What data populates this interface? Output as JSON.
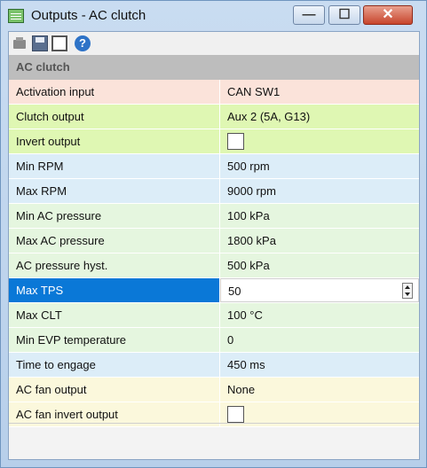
{
  "window": {
    "title": "Outputs - AC clutch",
    "controls": {
      "minimize": "—",
      "maximize": "☐",
      "close": "✕"
    }
  },
  "toolbar": {
    "icons": [
      "folder-open-icon",
      "save-icon",
      "window-icon",
      "help-icon"
    ],
    "help_glyph": "?"
  },
  "section": {
    "title": "AC clutch"
  },
  "rows": [
    {
      "label": "Activation input",
      "value": "CAN SW1",
      "color": "#fbe3da"
    },
    {
      "label": "Clutch output",
      "value": "Aux 2 (5A, G13)",
      "color": "#dff7b3"
    },
    {
      "label": "Invert output",
      "value": "",
      "checkbox": true,
      "checked": false,
      "color": "#dff7b3"
    },
    {
      "label": "Min RPM",
      "value": "500 rpm",
      "color": "#dcedf8"
    },
    {
      "label": "Max RPM",
      "value": "9000 rpm",
      "color": "#dcedf8"
    },
    {
      "label": "Min AC pressure",
      "value": "100 kPa",
      "color": "#e5f6df"
    },
    {
      "label": "Max AC pressure",
      "value": "1800 kPa",
      "color": "#e5f6df"
    },
    {
      "label": "AC pressure hyst.",
      "value": "500 kPa",
      "color": "#e5f6df"
    },
    {
      "label": "Max TPS",
      "value": "50",
      "selected": true,
      "spin": true
    },
    {
      "label": "Max CLT",
      "value": "100 °C",
      "color": "#e5f6df"
    },
    {
      "label": "Min EVP temperature",
      "value": "0",
      "color": "#e5f6df"
    },
    {
      "label": "Time to engage",
      "value": "450 ms",
      "color": "#dcedf8"
    },
    {
      "label": "AC fan output",
      "value": "None",
      "color": "#fbf8dc"
    },
    {
      "label": "AC fan invert output",
      "value": "",
      "checkbox": true,
      "checked": false,
      "color": "#fbf8dc"
    }
  ]
}
